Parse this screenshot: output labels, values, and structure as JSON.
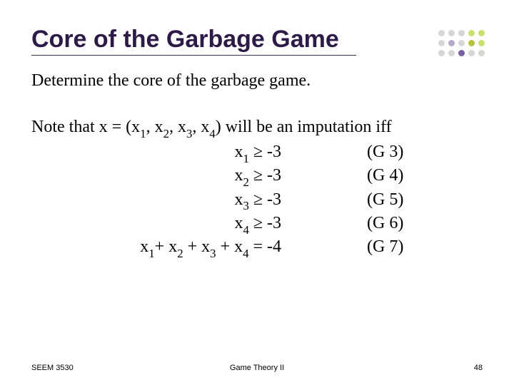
{
  "title": "Core of the Garbage Game",
  "intro": "Determine the core of the garbage game.",
  "note_prefix": "Note that x = (x",
  "note_mid1": ", x",
  "note_mid2": ", x",
  "note_mid3": ", x",
  "note_suffix": ") will be an imputation iff",
  "subs": {
    "s1": "1",
    "s2": "2",
    "s3": "3",
    "s4": "4"
  },
  "constraints": [
    {
      "lhs_var": "x",
      "lhs_sub": "1",
      "lhs_rest": " ≥ -3",
      "tag": "(G 3)"
    },
    {
      "lhs_var": "x",
      "lhs_sub": "2",
      "lhs_rest": " ≥ -3",
      "tag": "(G 4)"
    },
    {
      "lhs_var": "x",
      "lhs_sub": "3",
      "lhs_rest": " ≥ -3",
      "tag": "(G 5)"
    },
    {
      "lhs_var": "x",
      "lhs_sub": "4",
      "lhs_rest": " ≥ -3",
      "tag": "(G 6)"
    }
  ],
  "sum_line": {
    "t0": "x",
    "s0": "1",
    "t1": "+ x",
    "s1": "2",
    "t2": " + x",
    "s2": "3",
    "t3": " + x",
    "s3": "4",
    "t4": " = -4",
    "tag": "(G 7)"
  },
  "footer": {
    "left": "SEEM 3530",
    "center": "Game Theory II",
    "right": "48"
  }
}
